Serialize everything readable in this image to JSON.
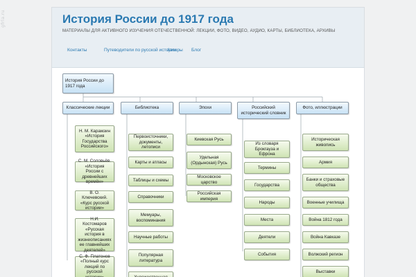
{
  "side_text": "gfrla.ru",
  "site": {
    "title": "История России до 1917 года",
    "description": "МАТЕРИАЛЫ ДЛЯ АКТИВНОГО ИЗУЧЕНИЯ ОТЕЧЕСТВЕННОЙ: ЛЕКЦИИ, ФОТО, ВИДЕО, АУДИО, КАРТЫ, БИБЛИОТЕКА, АРХИВЫ"
  },
  "nav": [
    "Контакты",
    "Путеводители по русской истории",
    "Авторы",
    "Блог"
  ],
  "colors": {
    "title": "#2a79b1",
    "header_bg": "#e8eef3",
    "category_box": "#c8e2f5",
    "item_box": "#cfe4b4"
  },
  "tree": {
    "root": "История России до 1917 года",
    "columns": [
      {
        "label": "Классические лекции",
        "items": [
          "Н. М. Карамзин «История Государства Российского»",
          "С. М. Соловьёв. «История России с древнейших времён»",
          "В. О. Ключевский. «Курс русской истории»",
          "Н.И. Костомаров «Русская история в жизнеописаниях ее главнейших деятелей»",
          "С. Ф. Платонов «Полный курс лекций по русской истории»"
        ]
      },
      {
        "label": "Библиотека",
        "items": [
          "Первоисточники, документы, летописи",
          "Карты и атласы",
          "Таблицы и схемы",
          "Справочники",
          "Мемуары, воспоминания",
          "Научные работы",
          "Популярная литература",
          "Художественная литература"
        ]
      },
      {
        "label": "Эпохи",
        "items": [
          "Киевская Русь",
          "Удельная (Ордынская) Русь",
          "Московское царство",
          "Российская империя"
        ]
      },
      {
        "label": "Российский исторический словник",
        "items": [
          "Из словаря Брокгауза и Ефрона",
          "Термины",
          "Государства",
          "Народы",
          "Места",
          "Деятели",
          "События"
        ]
      },
      {
        "label": "Фото, иллюстрации",
        "items": [
          "Историческая живопись",
          "Армия",
          "Банки и страховые общества",
          "Военные училища",
          "Война 1812 года",
          "Война Кавказе",
          "Волжский регион",
          "Выставки"
        ]
      }
    ]
  }
}
